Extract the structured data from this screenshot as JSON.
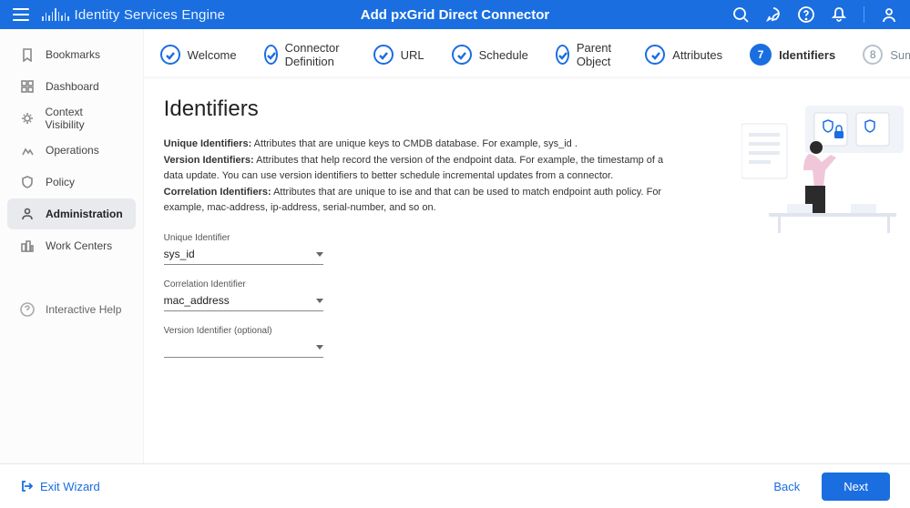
{
  "header": {
    "product": "Identity Services Engine",
    "page_title": "Add pxGrid Direct Connector"
  },
  "sidebar": {
    "items": [
      {
        "label": "Bookmarks"
      },
      {
        "label": "Dashboard"
      },
      {
        "label": "Context Visibility"
      },
      {
        "label": "Operations"
      },
      {
        "label": "Policy"
      },
      {
        "label": "Administration"
      },
      {
        "label": "Work Centers"
      }
    ],
    "help": "Interactive Help"
  },
  "stepper": {
    "steps": [
      {
        "label": "Welcome",
        "state": "done"
      },
      {
        "label": "Connector Definition",
        "state": "done"
      },
      {
        "label": "URL",
        "state": "done"
      },
      {
        "label": "Schedule",
        "state": "done"
      },
      {
        "label": "Parent Object",
        "state": "done"
      },
      {
        "label": "Attributes",
        "state": "done"
      },
      {
        "label": "Identifiers",
        "state": "cur",
        "num": "7"
      },
      {
        "label": "Summary",
        "state": "fut",
        "num": "8"
      }
    ]
  },
  "content": {
    "heading": "Identifiers",
    "p1_b": "Unique Identifiers:",
    "p1": " Attributes that are unique keys to CMDB database. For example, sys_id .",
    "p2_b": "Version Identifiers:",
    "p2": " Attributes that help record the version of the endpoint data. For example, the timestamp of a data update. You can use version identifiers to better schedule incremental updates from a connector.",
    "p3_b": "Correlation Identifiers:",
    "p3": " Attributes that are unique to ise and that can be used to match endpoint auth policy. For example, mac-address, ip-address, serial-number, and so on.",
    "fields": {
      "unique": {
        "label": "Unique Identifier",
        "value": "sys_id"
      },
      "corr": {
        "label": "Correlation Identifier",
        "value": "mac_address"
      },
      "ver": {
        "label": "Version Identifier (optional)",
        "value": ""
      }
    }
  },
  "footer": {
    "exit": "Exit Wizard",
    "back": "Back",
    "next": "Next"
  }
}
